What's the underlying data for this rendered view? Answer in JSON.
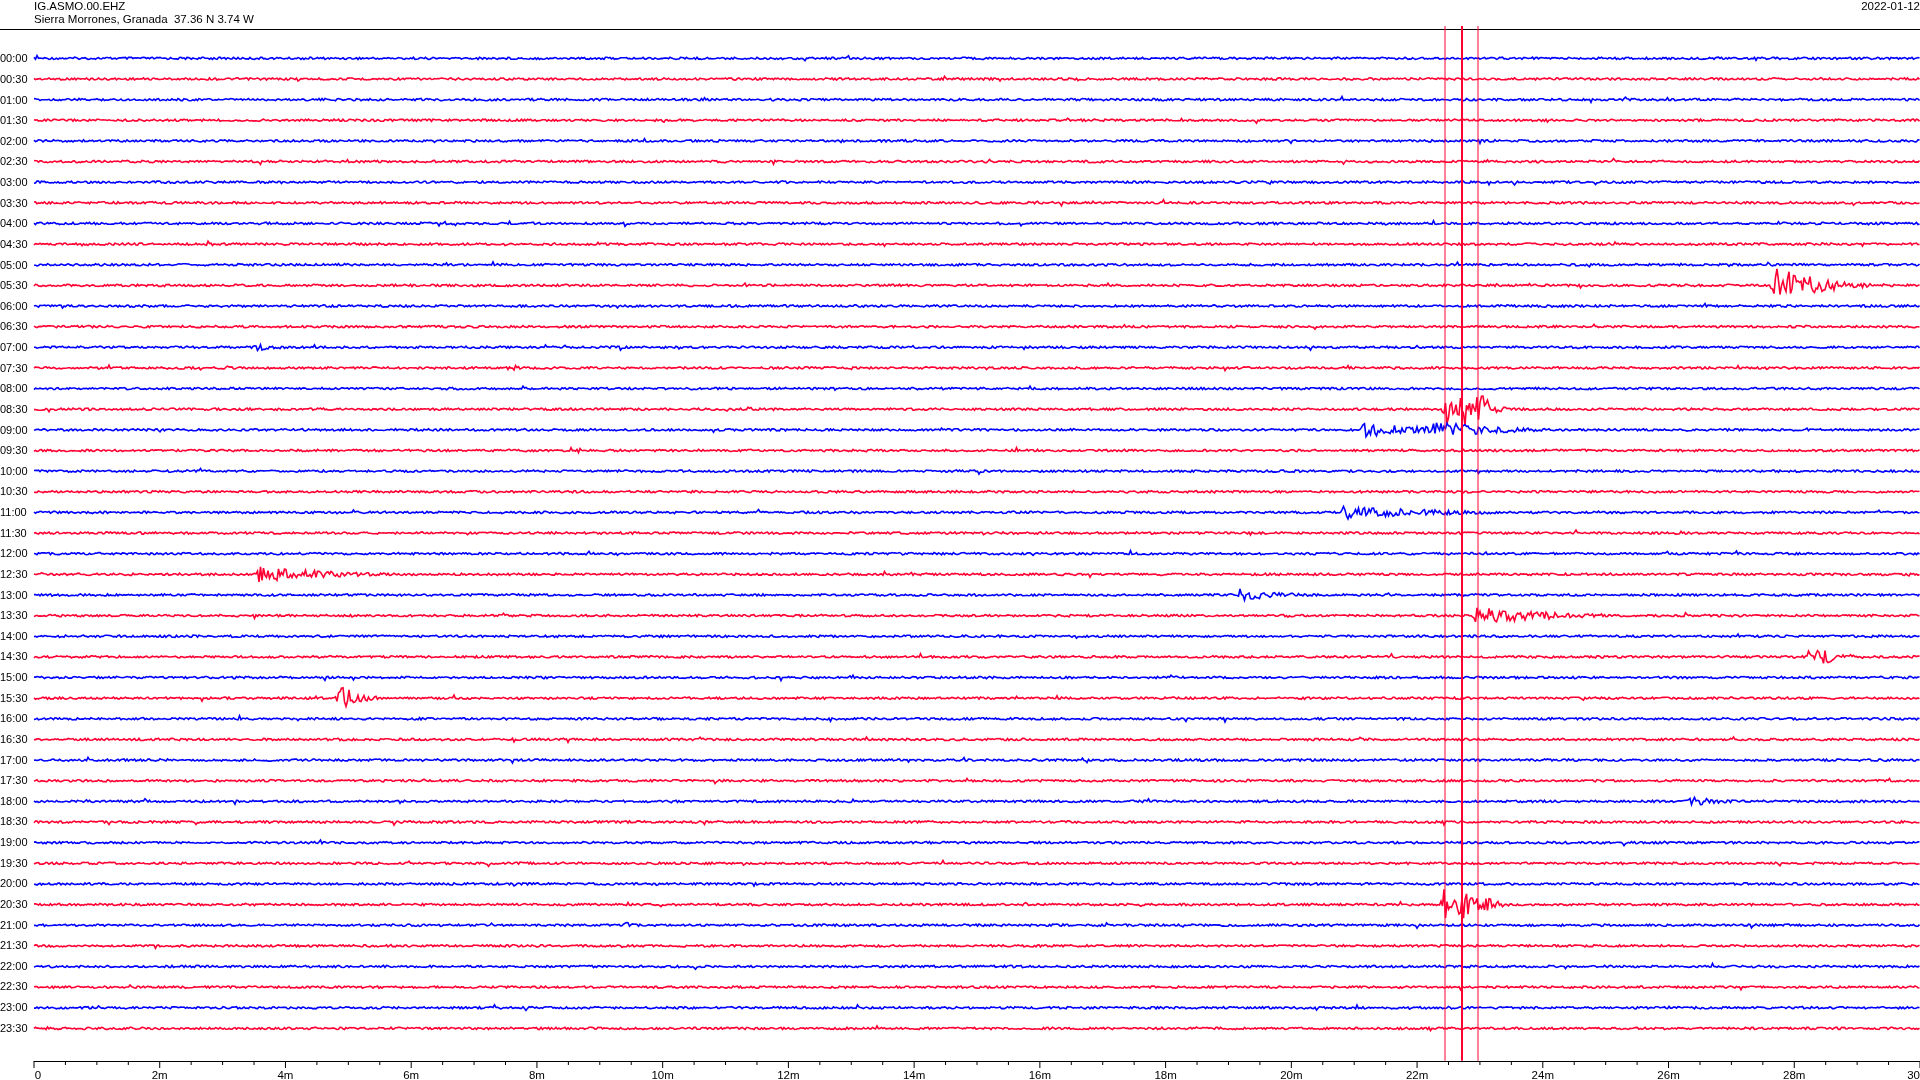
{
  "header": {
    "channel": "IG.ASMO.00.EHZ",
    "station": "Sierra Morrones, Granada  37.36 N 3.74 W",
    "date": "2022-01-12"
  },
  "rows": [
    {
      "label": "00:00",
      "color": "#0000ff"
    },
    {
      "label": "00:30",
      "color": "#ff0033"
    },
    {
      "label": "01:00",
      "color": "#0000ff"
    },
    {
      "label": "01:30",
      "color": "#ff0033"
    },
    {
      "label": "02:00",
      "color": "#0000ff"
    },
    {
      "label": "02:30",
      "color": "#ff0033"
    },
    {
      "label": "03:00",
      "color": "#0000ff"
    },
    {
      "label": "03:30",
      "color": "#ff0033"
    },
    {
      "label": "04:00",
      "color": "#0000ff"
    },
    {
      "label": "04:30",
      "color": "#ff0033"
    },
    {
      "label": "05:00",
      "color": "#0000ff"
    },
    {
      "label": "05:30",
      "color": "#ff0033"
    },
    {
      "label": "06:00",
      "color": "#0000ff"
    },
    {
      "label": "06:30",
      "color": "#ff0033"
    },
    {
      "label": "07:00",
      "color": "#0000ff"
    },
    {
      "label": "07:30",
      "color": "#ff0033"
    },
    {
      "label": "08:00",
      "color": "#0000ff"
    },
    {
      "label": "08:30",
      "color": "#ff0033"
    },
    {
      "label": "09:00",
      "color": "#0000ff"
    },
    {
      "label": "09:30",
      "color": "#ff0033"
    },
    {
      "label": "10:00",
      "color": "#0000ff"
    },
    {
      "label": "10:30",
      "color": "#ff0033"
    },
    {
      "label": "11:00",
      "color": "#0000ff"
    },
    {
      "label": "11:30",
      "color": "#ff0033"
    },
    {
      "label": "12:00",
      "color": "#0000ff"
    },
    {
      "label": "12:30",
      "color": "#ff0033"
    },
    {
      "label": "13:00",
      "color": "#0000ff"
    },
    {
      "label": "13:30",
      "color": "#ff0033"
    },
    {
      "label": "14:00",
      "color": "#0000ff"
    },
    {
      "label": "14:30",
      "color": "#ff0033"
    },
    {
      "label": "15:00",
      "color": "#0000ff"
    },
    {
      "label": "15:30",
      "color": "#ff0033"
    },
    {
      "label": "16:00",
      "color": "#0000ff"
    },
    {
      "label": "16:30",
      "color": "#ff0033"
    },
    {
      "label": "17:00",
      "color": "#0000ff"
    },
    {
      "label": "17:30",
      "color": "#ff0033"
    },
    {
      "label": "18:00",
      "color": "#0000ff"
    },
    {
      "label": "18:30",
      "color": "#ff0033"
    },
    {
      "label": "19:00",
      "color": "#0000ff"
    },
    {
      "label": "19:30",
      "color": "#ff0033"
    },
    {
      "label": "20:00",
      "color": "#0000ff"
    },
    {
      "label": "20:30",
      "color": "#ff0033"
    },
    {
      "label": "21:00",
      "color": "#0000ff"
    },
    {
      "label": "21:30",
      "color": "#ff0033"
    },
    {
      "label": "22:00",
      "color": "#0000ff"
    },
    {
      "label": "22:30",
      "color": "#ff0033"
    },
    {
      "label": "23:00",
      "color": "#0000ff"
    },
    {
      "label": "23:30",
      "color": "#ff0033"
    }
  ],
  "x_axis": {
    "ticks": [
      "0",
      "2m",
      "4m",
      "6m",
      "8m",
      "10m",
      "12m",
      "14m",
      "16m",
      "18m",
      "20m",
      "22m",
      "24m",
      "26m",
      "28m",
      "30"
    ]
  }
}
